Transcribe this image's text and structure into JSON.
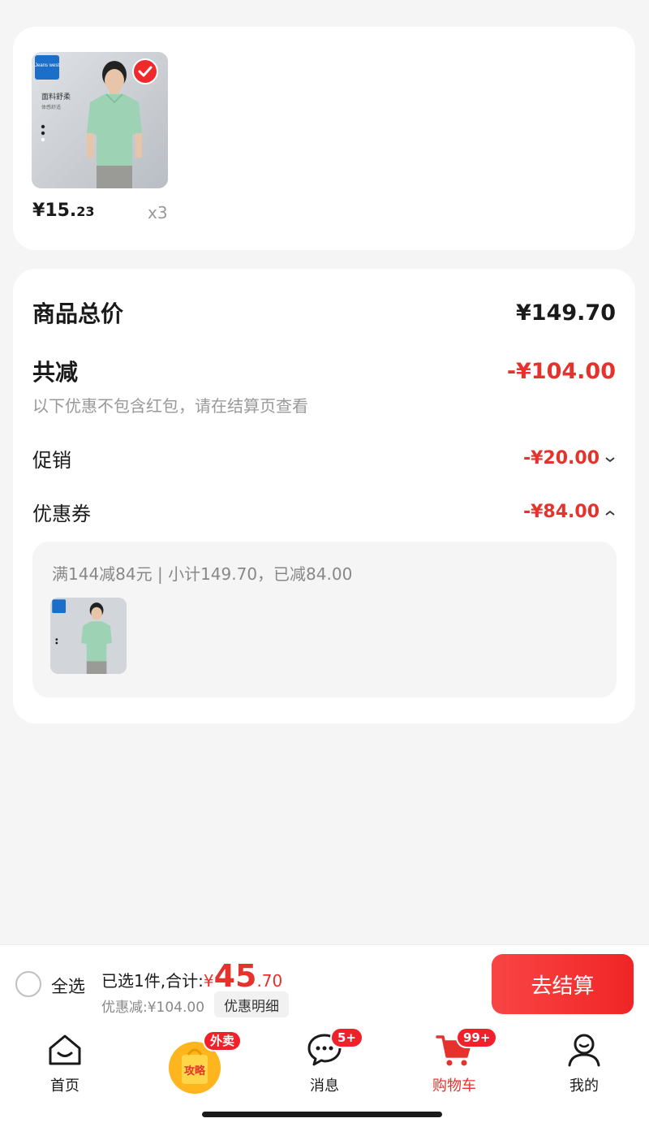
{
  "product": {
    "image_caption_brand": "Jeans west",
    "image_caption_text": "面料舒柔",
    "image_caption_sub": "体感舒适",
    "price_symbol": "¥",
    "price_int": "15.",
    "price_dec": "23",
    "quantity": "x3"
  },
  "summary": {
    "total_label": "商品总价",
    "total_value": "¥149.70",
    "reduce_label": "共减",
    "reduce_value": "-¥104.00",
    "note": "以下优惠不包含红包，请在结算页查看",
    "promo_label": "促销",
    "promo_value": "-¥20.00",
    "coupon_label": "优惠券",
    "coupon_value": "-¥84.00",
    "coupon_detail": "满144减84元 | 小计149.70，已减84.00"
  },
  "checkout": {
    "select_all": "全选",
    "selected_prefix": "已选1件,合计:",
    "total_symbol": "¥",
    "total_int": "45",
    "total_dec": ".70",
    "discount_text": "优惠减:¥104.00",
    "detail_button": "优惠明细",
    "pay_button": "去结算"
  },
  "tabs": [
    {
      "label": "首页",
      "icon": "home-icon"
    },
    {
      "label": "攻略",
      "icon": "food-delivery-icon",
      "badge": "外卖"
    },
    {
      "label": "消息",
      "icon": "message-icon",
      "badge": "5+"
    },
    {
      "label": "购物车",
      "icon": "cart-icon",
      "badge": "99+",
      "active": true
    },
    {
      "label": "我的",
      "icon": "profile-icon"
    }
  ],
  "colors": {
    "accent": "#e5322d",
    "pay_button": "#f02525",
    "background": "#f5f5f5"
  }
}
